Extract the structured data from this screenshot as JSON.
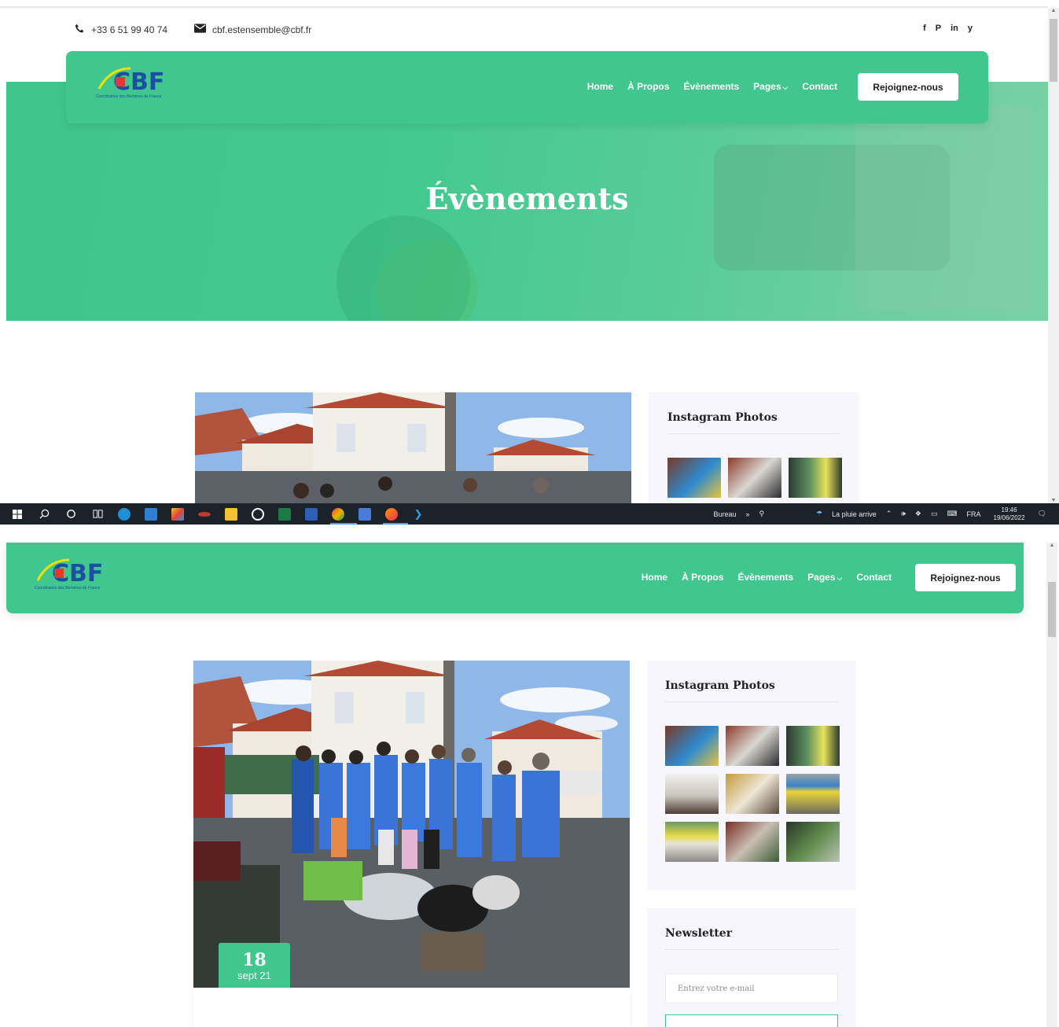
{
  "contact": {
    "phone": "+33 6 51 99 40 74",
    "email": "cbf.estensemble@cbf.fr"
  },
  "social": [
    "f",
    "P",
    "in",
    "y"
  ],
  "logo": {
    "text": "CBF",
    "tagline": "Coordination des Berbères de France"
  },
  "nav": {
    "home": "Home",
    "about": "À Propos",
    "events": "Évènements",
    "pages": "Pages",
    "contact": "Contact",
    "join": "Rejoignez-nous"
  },
  "hero": {
    "title": "Évènements"
  },
  "sidebar": {
    "instagram_title": "Instagram Photos",
    "newsletter_title": "Newsletter",
    "newsletter_placeholder": "Entrez votre e-mail"
  },
  "post": {
    "day": "18",
    "month": "sept 21"
  },
  "taskbar": {
    "desktop": "Bureau",
    "weather": "La pluie arrive",
    "language": "FRA",
    "time": "19:46",
    "date": "19/06/2022"
  },
  "colors": {
    "brand_green": "#41c78e",
    "white": "#ffffff",
    "sidebar_bg": "#f8f6fd",
    "taskbar_bg": "#1c2229"
  },
  "icons": [
    "phone-icon",
    "envelope-icon",
    "facebook-icon",
    "pinterest-icon",
    "linkedin-icon",
    "twitter-icon",
    "chevron-down-icon",
    "windows-start-icon",
    "search-icon",
    "cortana-icon",
    "task-view-icon"
  ]
}
